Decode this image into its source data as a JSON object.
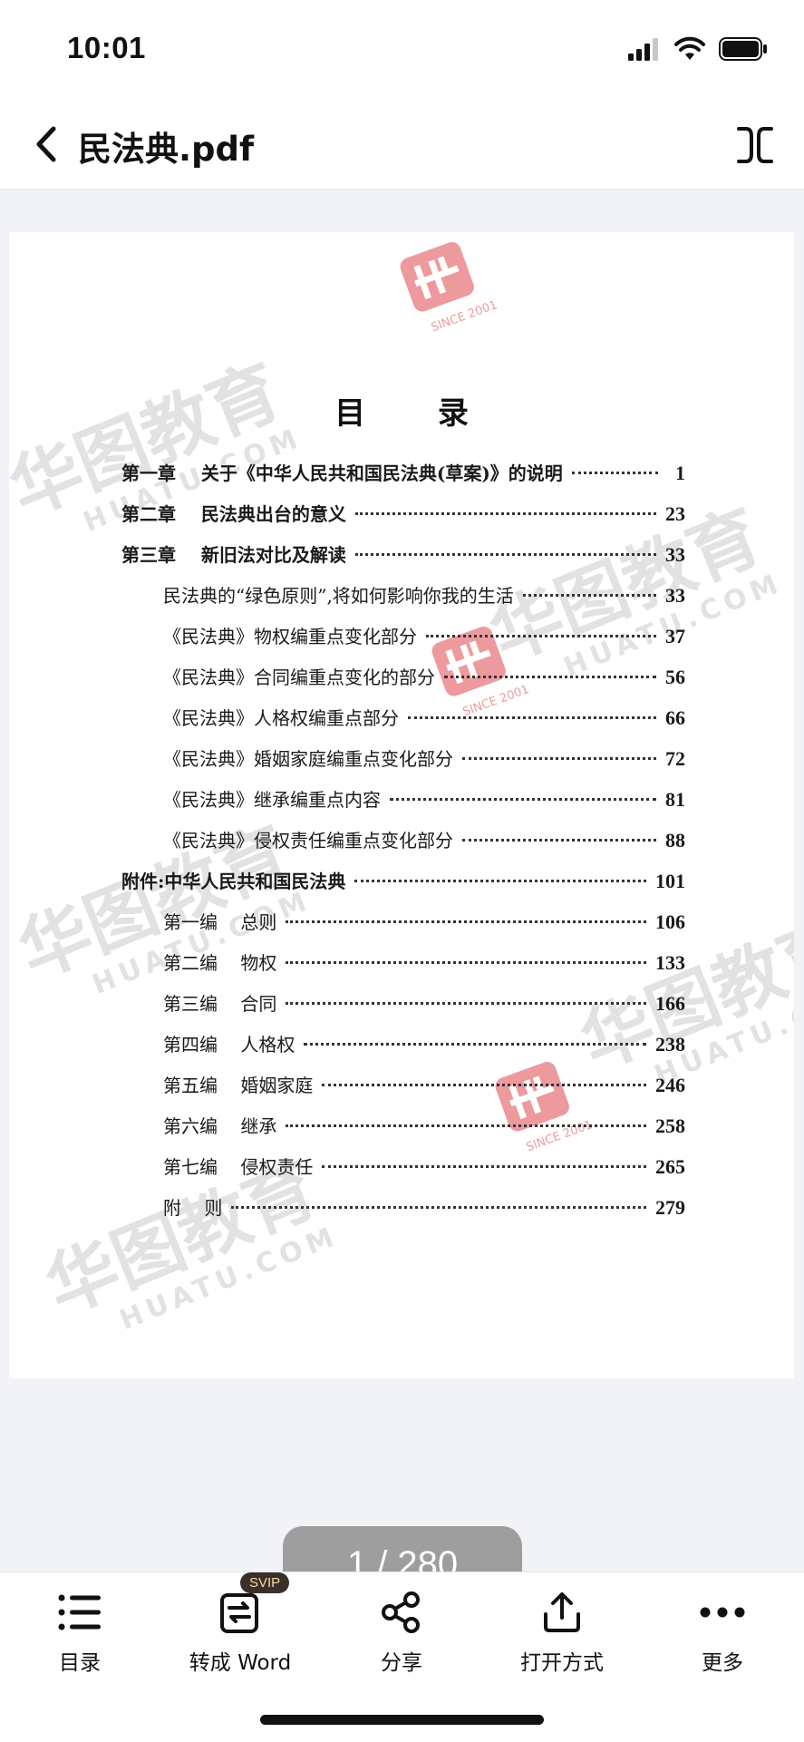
{
  "status_bar": {
    "time": "10:01"
  },
  "nav": {
    "title": "民法典.pdf"
  },
  "toc": {
    "heading": "目 录",
    "entries": [
      {
        "label": "第一章    关于《中华人民共和国民法典(草案)》的说明",
        "page": "1"
      },
      {
        "label": "第二章    民法典出台的意义",
        "page": "23"
      },
      {
        "label": "第三章    新旧法对比及解读",
        "page": "33"
      },
      {
        "label": "民法典的“绿色原则”,将如何影响你我的生活",
        "page": "33"
      },
      {
        "label": "《民法典》物权编重点变化部分",
        "page": "37"
      },
      {
        "label": "《民法典》合同编重点变化的部分",
        "page": "56"
      },
      {
        "label": "《民法典》人格权编重点部分",
        "page": "66"
      },
      {
        "label": "《民法典》婚姻家庭编重点变化部分",
        "page": "72"
      },
      {
        "label": "《民法典》继承编重点内容",
        "page": "81"
      },
      {
        "label": "《民法典》侵权责任编重点变化部分",
        "page": "88"
      },
      {
        "label": "附件:中华人民共和国民法典",
        "page": "101"
      },
      {
        "label": "第一编    总则",
        "page": "106"
      },
      {
        "label": "第二编    物权",
        "page": "133"
      },
      {
        "label": "第三编    合同",
        "page": "166"
      },
      {
        "label": "第四编    人格权",
        "page": "238"
      },
      {
        "label": "第五编    婚姻家庭",
        "page": "246"
      },
      {
        "label": "第六编    继承",
        "page": "258"
      },
      {
        "label": "第七编    侵权责任",
        "page": "265"
      },
      {
        "label": "附    则",
        "page": "279"
      }
    ]
  },
  "watermark": {
    "brand": "华图教育",
    "site": "HUATU.COM",
    "since": "SINCE 2001"
  },
  "page_indicator": {
    "text": "1 / 280"
  },
  "toolbar": {
    "toc_label": "目录",
    "to_word_label": "转成 Word",
    "svip_badge": "SVIP",
    "share_label": "分享",
    "open_with_label": "打开方式",
    "more_label": "更多"
  },
  "colors": {
    "accent_watermark": "#e0494f",
    "badge_bg": "#3a2f2a",
    "badge_text": "#f3d9a6"
  }
}
